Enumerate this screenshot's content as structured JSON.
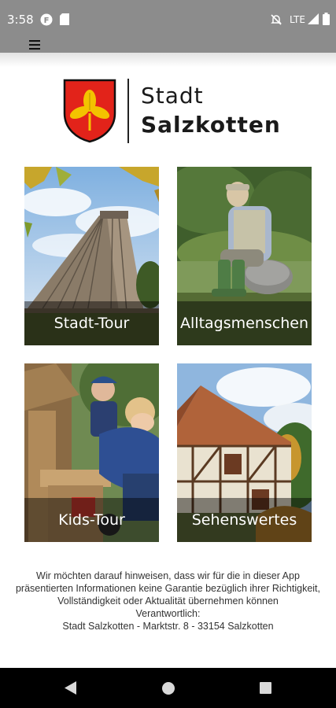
{
  "status_bar": {
    "time": "3:58",
    "network": "LTE",
    "icons": [
      "app-notification-icon",
      "sd-card-icon",
      "mute-icon",
      "signal-icon",
      "battery-icon"
    ]
  },
  "toolbar": {
    "menu_icon": "hamburger-menu-icon"
  },
  "logo": {
    "line1": "Stadt",
    "line2": "Salzkotten",
    "crest_icon": "coat-of-arms-icon"
  },
  "tiles": [
    {
      "label": "Stadt-Tour"
    },
    {
      "label": "Alltagsmenschen"
    },
    {
      "label": "Kids-Tour"
    },
    {
      "label": "Sehenswertes"
    }
  ],
  "disclaimer": {
    "lines": [
      "Wir möchten darauf hinweisen, dass wir für die in dieser App",
      "präsentierten Informationen keine Garantie bezüglich ihrer Richtigkeit,",
      "Vollständigkeit oder Aktualität übernehmen können",
      "Verantwortlich:",
      "Stadt Salzkotten - Marktstr. 8 - 33154 Salzkotten"
    ]
  },
  "nav_bar": {
    "back_icon": "back-icon",
    "home_icon": "home-icon",
    "recents_icon": "recents-icon"
  },
  "colors": {
    "status_bar": "#8c8c8c",
    "crest_red": "#e2231a",
    "crest_yellow": "#f3c300"
  }
}
